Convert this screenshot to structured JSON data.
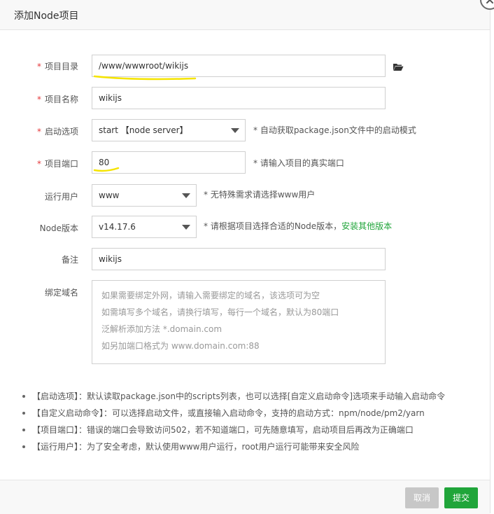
{
  "dialog": {
    "title": "添加Node项目",
    "close_icon": "close-icon"
  },
  "form": {
    "project_dir": {
      "label": "项目目录",
      "required": "*",
      "value": "/www/wwwroot/wikijs",
      "folder_icon": "folder-open-icon"
    },
    "project_name": {
      "label": "项目名称",
      "required": "*",
      "value": "wikijs"
    },
    "start_option": {
      "label": "启动选项",
      "required": "*",
      "value": "start 【node server】",
      "hint": "* 自动获取package.json文件中的启动模式"
    },
    "project_port": {
      "label": "项目端口",
      "required": "*",
      "value": "80",
      "hint": "* 请输入项目的真实端口"
    },
    "run_user": {
      "label": "运行用户",
      "value": "www",
      "hint": "* 无特殊需求请选择www用户"
    },
    "node_version": {
      "label": "Node版本",
      "value": "v14.17.6",
      "hint": "* 请根据项目选择合适的Node版本，",
      "hint_link": "安装其他版本"
    },
    "remark": {
      "label": "备注",
      "value": "wikijs"
    },
    "domain": {
      "label": "绑定域名",
      "placeholder_lines": [
        "如果需要绑定外网，请输入需要绑定的域名，该选项可为空",
        "如需填写多个域名，请换行填写，每行一个域名，默认为80端口",
        "泛解析添加方法 *.domain.com",
        "如另加端口格式为 www.domain.com:88"
      ]
    }
  },
  "notes": [
    "【启动选项】：默认读取package.json中的scripts列表，也可以选择[自定义启动命令]选项来手动输入启动命令",
    "【自定义启动命令】：可以选择启动文件，或直接输入启动命令，支持的启动方式：npm/node/pm2/yarn",
    "【项目端口】：错误的端口会导致访问502，若不知道端口，可先随意填写，启动项目后再改为正确端口",
    "【运行用户】：为了安全考虑，默认使用www用户运行，root用户运行可能带来安全风险"
  ],
  "footer": {
    "cancel_label": "取消",
    "submit_label": "提交"
  },
  "colors": {
    "accent_green": "#20a53a",
    "required_red": "#e4393c",
    "highlight_yellow": "#f5e400"
  }
}
